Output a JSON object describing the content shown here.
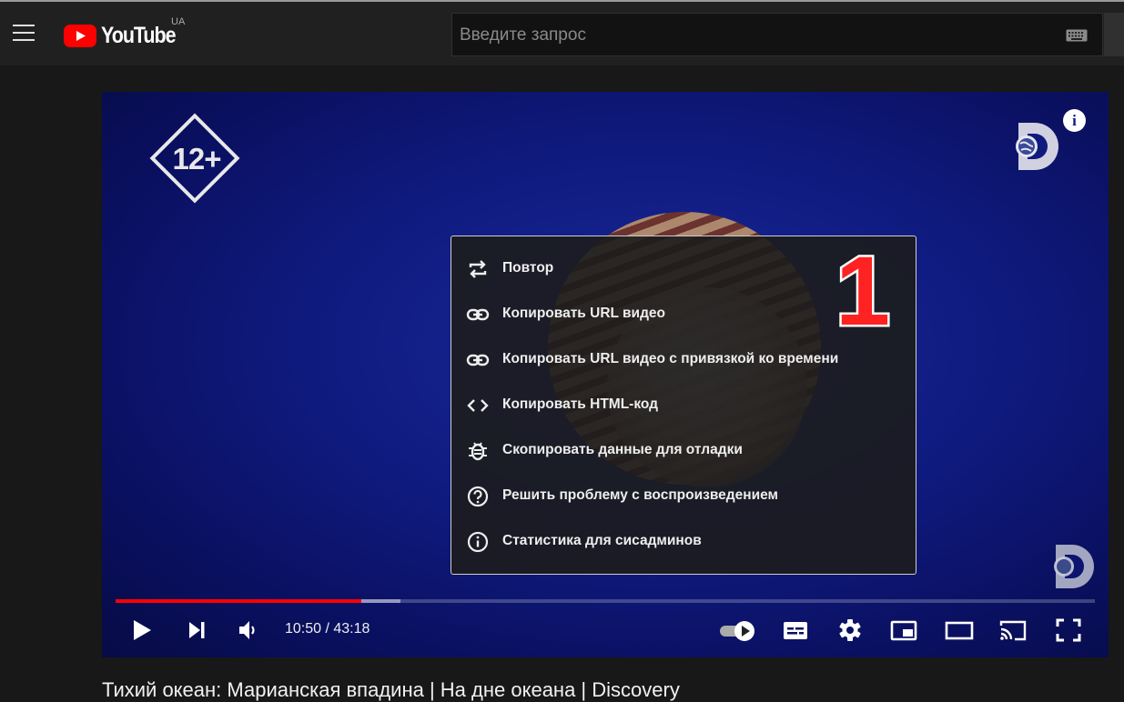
{
  "header": {
    "logo_text": "YouTube",
    "region": "UA",
    "search_placeholder": "Введите запрос"
  },
  "player": {
    "age_rating": "12+",
    "info_icon": "i",
    "annotation_number": "1",
    "current_time": "10:50",
    "duration": "43:18",
    "time_display": "10:50 / 43:18",
    "progress_played": 0.251,
    "progress_buffered": 0.291,
    "autoplay_on": true
  },
  "context_menu": {
    "items": [
      {
        "label": "Повтор",
        "icon": "loop-icon"
      },
      {
        "label": "Копировать URL видео",
        "icon": "link-icon"
      },
      {
        "label": "Копировать URL видео с привязкой ко времени",
        "icon": "link-icon"
      },
      {
        "label": "Копировать HTML-код",
        "icon": "embed-code-icon"
      },
      {
        "label": "Скопировать данные для отладки",
        "icon": "bug-icon"
      },
      {
        "label": "Решить проблему с воспроизведением",
        "icon": "help-circle-icon"
      },
      {
        "label": "Статистика для сисадминов",
        "icon": "info-circle-icon"
      }
    ]
  },
  "video": {
    "title": "Тихий океан: Марианская впадина | На дне океана | Discovery"
  },
  "colors": {
    "accent": "#ff0000",
    "annotation": "#ff2222",
    "player_bg": "#0f1a7e"
  }
}
